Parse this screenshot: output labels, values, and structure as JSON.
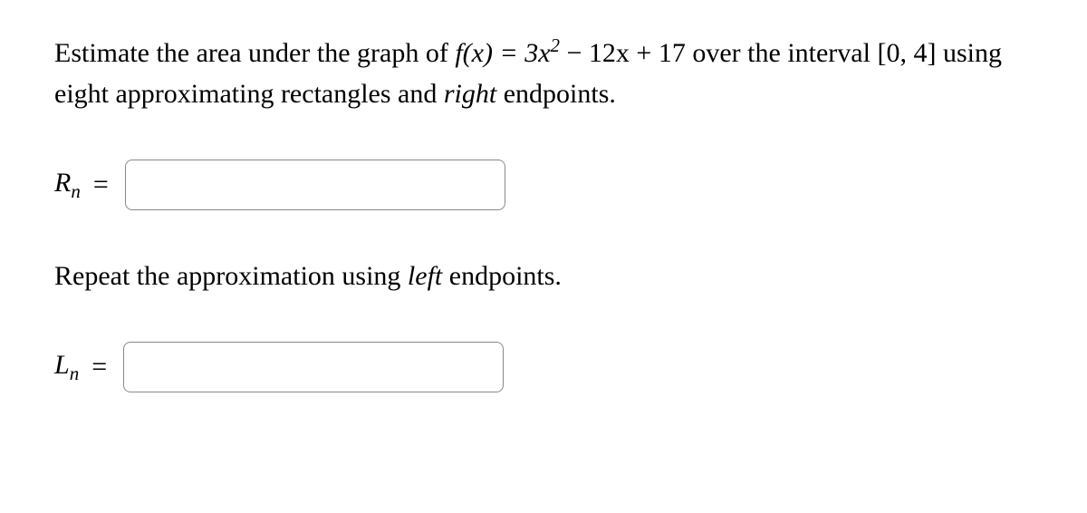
{
  "problem": {
    "text_part1": "Estimate the area under the graph of ",
    "fx_expr": "f(x) = 3x",
    "fx_exp": "2",
    "fx_tail": " − 12x + 17",
    "text_part2": " over the interval ",
    "interval": "[0, 4]",
    "text_part3": " using eight approximating rectangles and ",
    "emphasis1": "right",
    "text_part4": " endpoints."
  },
  "rn": {
    "var": "R",
    "sub": "n",
    "equals": "="
  },
  "repeat": {
    "text1": "Repeat the approximation using ",
    "emphasis": "left",
    "text2": " endpoints."
  },
  "ln": {
    "var": "L",
    "sub": "n",
    "equals": "="
  }
}
